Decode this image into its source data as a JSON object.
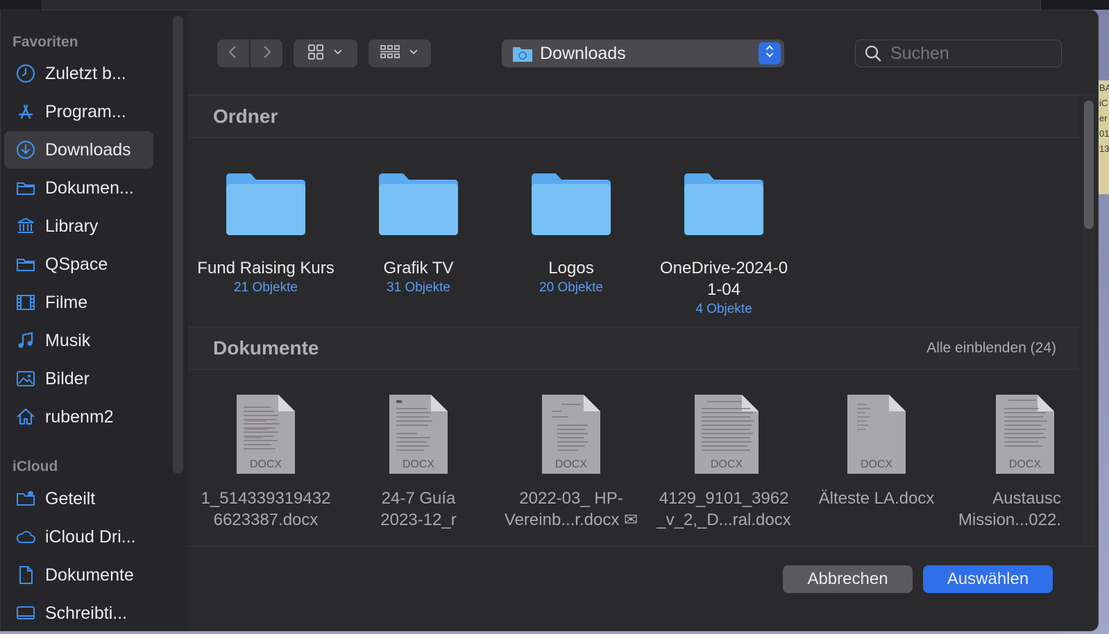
{
  "sidebar": {
    "favorites_label": "Favoriten",
    "icloud_label": "iCloud",
    "favorites": [
      {
        "label": "Zuletzt b...",
        "icon": "clock-icon"
      },
      {
        "label": "Program...",
        "icon": "apps-icon"
      },
      {
        "label": "Downloads",
        "icon": "download-icon",
        "active": true
      },
      {
        "label": "Dokumen...",
        "icon": "folder-icon"
      },
      {
        "label": "Library",
        "icon": "library-icon"
      },
      {
        "label": "QSpace",
        "icon": "folder-icon"
      },
      {
        "label": "Filme",
        "icon": "film-icon"
      },
      {
        "label": "Musik",
        "icon": "music-icon"
      },
      {
        "label": "Bilder",
        "icon": "photo-icon"
      },
      {
        "label": "rubenm2",
        "icon": "home-icon"
      }
    ],
    "icloud": [
      {
        "label": "Geteilt",
        "icon": "shared-folder-icon"
      },
      {
        "label": "iCloud Dri...",
        "icon": "cloud-icon"
      },
      {
        "label": "Dokumente",
        "icon": "document-icon"
      },
      {
        "label": "Schreibti...",
        "icon": "desktop-icon"
      }
    ]
  },
  "toolbar": {
    "location": "Downloads",
    "search_placeholder": "Suchen"
  },
  "folders_section": {
    "title": "Ordner",
    "items": [
      {
        "name": "Fund Raising Kurs",
        "count": "21 Objekte"
      },
      {
        "name": "Grafik TV",
        "count": "31 Objekte"
      },
      {
        "name": "Logos",
        "count": "20 Objekte"
      },
      {
        "name": "OneDrive-2024-0\n1-04",
        "count": "4 Objekte"
      }
    ]
  },
  "documents_section": {
    "title": "Dokumente",
    "show_all": "Alle einblenden (24)",
    "badge": "DOCX",
    "items": [
      {
        "name": "1_514339319432\n6623387.docx"
      },
      {
        "name": "24-7 Guía\n2023-12_r"
      },
      {
        "name": "2022-03_ HP-\nVereinb...r.docx ✉"
      },
      {
        "name": "4129_9101_3962\n_v_2,_D...ral.docx"
      },
      {
        "name": "Älteste LA.docx"
      },
      {
        "name": "Austausc\nMission...022."
      }
    ]
  },
  "buttons": {
    "cancel": "Abbrechen",
    "confirm": "Auswählen"
  },
  "colors": {
    "accent": "#2f6fe8",
    "folder": "#6bb8f3",
    "sidebar_icon": "#3a8ff0"
  }
}
